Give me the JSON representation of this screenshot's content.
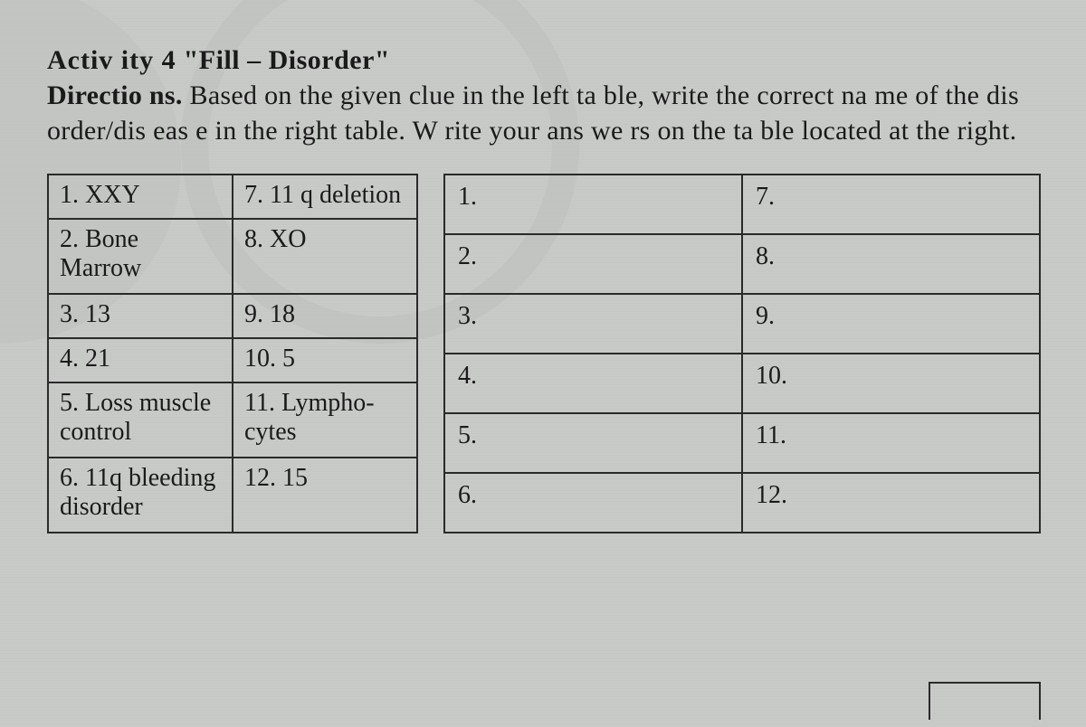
{
  "header": {
    "activity_label": "Activ ity 4",
    "activity_title": "\"Fill – Disorder\"",
    "directions_label": "Directio ns.",
    "directions_text": " Based on the given clue in the left ta ble, write the correct na me of the dis order/dis eas e in the right table. W rite your ans we rs on the ta ble located at the right."
  },
  "clue_table": {
    "rows": [
      {
        "left": "1. XXY",
        "right": "7. 11 q deletion"
      },
      {
        "left": "2. Bone Marrow",
        "right": "8. XO"
      },
      {
        "left": "3. 13",
        "right": "9. 18"
      },
      {
        "left": "4. 21",
        "right": "10. 5"
      },
      {
        "left": "5. Loss muscle control",
        "right": "11. Lympho- cytes"
      },
      {
        "left": "6. 11q bleeding disorder",
        "right": "12. 15"
      }
    ]
  },
  "answer_table": {
    "rows": [
      {
        "left": "1.",
        "right": "7."
      },
      {
        "left": "2.",
        "right": "8."
      },
      {
        "left": "3.",
        "right": "9."
      },
      {
        "left": "4.",
        "right": "10."
      },
      {
        "left": "5.",
        "right": "11."
      },
      {
        "left": "6.",
        "right": "12."
      }
    ]
  }
}
